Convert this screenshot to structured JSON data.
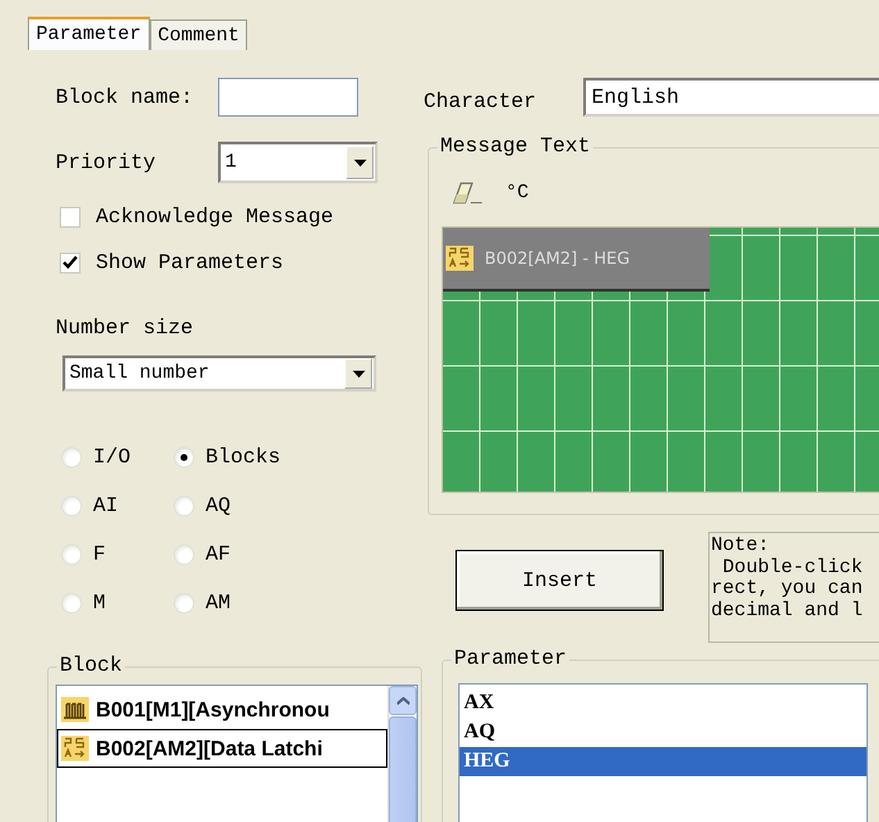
{
  "tabs": [
    {
      "label": "Parameter",
      "selected": true
    },
    {
      "label": "Comment",
      "selected": false
    }
  ],
  "block_name": {
    "label": "Block name:"
  },
  "priority": {
    "label": "Priority",
    "value": "1"
  },
  "checkboxes": [
    {
      "label": "Acknowledge Message",
      "checked": false
    },
    {
      "label": "Show Parameters",
      "checked": true
    }
  ],
  "number_size": {
    "label": "Number size",
    "value": "Small number"
  },
  "radios": [
    {
      "label": "I/O",
      "selected": false
    },
    {
      "label": "Blocks",
      "selected": true
    },
    {
      "label": "AI",
      "selected": false
    },
    {
      "label": "AQ",
      "selected": false
    },
    {
      "label": "F",
      "selected": false
    },
    {
      "label": "AF",
      "selected": false
    },
    {
      "label": "M",
      "selected": false
    },
    {
      "label": "AM",
      "selected": false
    }
  ],
  "block_group": {
    "title": "Block",
    "items": [
      {
        "kind": "pulse",
        "text": "B001[M1][Asynchronou",
        "selected": false
      },
      {
        "kind": "latch",
        "text": "B002[AM2][Data Latchi",
        "selected": true
      }
    ]
  },
  "character": {
    "label": "Character",
    "value": "English"
  },
  "message_text": {
    "title": "Message Text",
    "degree_button": "°C",
    "grid_item": {
      "kind": "latch",
      "text": "B002[AM2] - HEG"
    }
  },
  "insert_button": "Insert",
  "note": [
    "Note:",
    " Double-click",
    "rect, you can",
    "decimal and l"
  ],
  "parameter_group": {
    "title": "Parameter",
    "items": [
      {
        "text": "AX",
        "selected": false
      },
      {
        "text": "AQ",
        "selected": false
      },
      {
        "text": "HEG",
        "selected": true
      }
    ]
  }
}
